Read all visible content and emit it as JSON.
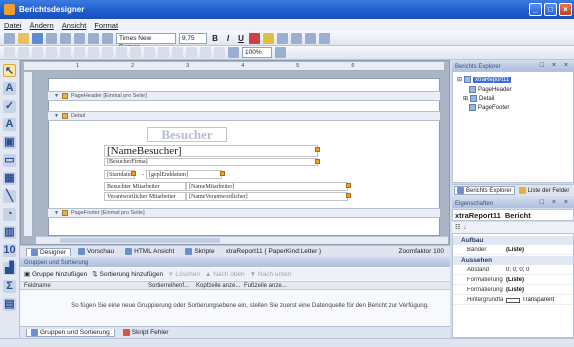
{
  "window": {
    "title": "Berichtsdesigner"
  },
  "menu": [
    "Datei",
    "Ändern",
    "Ansicht",
    "Format"
  ],
  "toolbar": {
    "font_family": "Times New Roman",
    "font_size": "9,75",
    "bold": "B",
    "italic": "I",
    "underline": "U",
    "zoom": "100%"
  },
  "bands": {
    "page_header": "PageHeader [Einmal pro Seite]",
    "detail": "Detail",
    "page_footer": "PageFooter [Einmal pro Seite]"
  },
  "fields": {
    "title": "Besucher",
    "name": "[NameBesucher]",
    "firma": "[BesucherFirma]",
    "start": "[Startdatu",
    "dash": "-",
    "end": "[geplEnddatum]",
    "mitarbeiter_label": "Besuchter Mitarbeiter",
    "mitarbeiter_value": "[NameMitarbeiter]",
    "verantwortlich_label": "Verantwortlicher Mitarbeiter",
    "verantwortlich_value": "[NameVerantwortlicher]"
  },
  "designer_tabs": [
    "Designer",
    "Vorschau",
    "HTML Ansicht",
    "Skripte",
    "xtraReport11 { PaperKind:Letter }"
  ],
  "zoom_label": "Zoomfaktor 100",
  "grouping": {
    "title": "Gruppen und Sortierung",
    "add_group": "Gruppe hinzufügen",
    "add_sort": "Sortierung hinzufügen",
    "delete": "Löschen",
    "move_up": "Nach oben",
    "move_down": "Nach unten",
    "col_field": "Feldname",
    "col_sort": "Sortierreihenf...",
    "col_header": "Kopfzeile anze...",
    "col_footer": "Fußzeile anze...",
    "hint": "So fügen Sie eine neue Gruppierung oder Sortierungsebene ein, stellen Sie zuerst eine Datenquelle für den Bericht zur Verfügung."
  },
  "bottom_tabs": [
    "Gruppen und Sortierung",
    "Skript Fehler"
  ],
  "explorer": {
    "title": "Berichts Explorer",
    "nodes": [
      "xtraReport11",
      "PageHeader",
      "Detail",
      "PageFooter"
    ]
  },
  "right_tabs": [
    "Berichts Explorer",
    "Liste der Felder"
  ],
  "properties": {
    "title": "Eigenschaften",
    "object_name": "xtraReport11",
    "object_type": "Bericht",
    "cat_aufbau": "Aufbau",
    "baender_name": "Bänder",
    "baender_value": "(Liste)",
    "cat_aussehen": "Aussehen",
    "abstand_name": "Abstand",
    "abstand_value": "0; 0; 0; 0",
    "format1_name": "Formatierungsr",
    "format1_value": "(Liste)",
    "format2_name": "Formatierungsr",
    "format2_value": "(Liste)",
    "hintergrund_name": "Hintergrundfarb",
    "hintergrund_value": "Transparent"
  }
}
